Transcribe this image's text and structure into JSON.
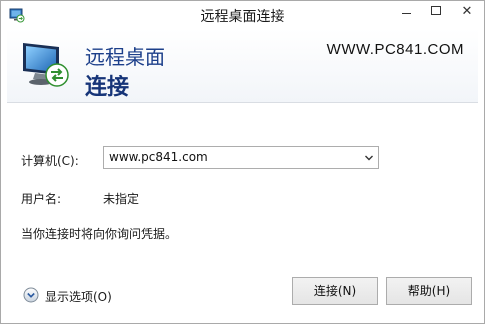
{
  "window": {
    "title": "远程桌面连接",
    "min_label": "",
    "max_label": "",
    "close_label": "✕"
  },
  "banner": {
    "title_line1": "远程桌面",
    "title_line2": "连接",
    "site": "WWW.PC841.COM",
    "icon": "remote-desktop-icon"
  },
  "form": {
    "computer_label": "计算机(C):",
    "computer_value": "www.pc841.com",
    "user_label": "用户名:",
    "user_value": "未指定",
    "note": "当你连接时将向你询问凭据。"
  },
  "footer": {
    "options_label": "显示选项(O)",
    "connect_label": "连接(N)",
    "help_label": "帮助(H)"
  },
  "colors": {
    "banner_title": "#1c3f8a",
    "accent": "#1e73be"
  }
}
